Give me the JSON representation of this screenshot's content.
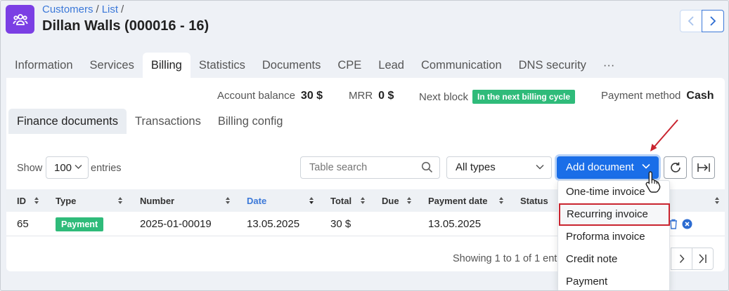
{
  "breadcrumb": {
    "items": [
      "Customers",
      "List"
    ]
  },
  "title": "Dillan Walls (000016 - 16)",
  "tabs": [
    {
      "label": "Information"
    },
    {
      "label": "Services"
    },
    {
      "label": "Billing"
    },
    {
      "label": "Statistics"
    },
    {
      "label": "Documents"
    },
    {
      "label": "CPE"
    },
    {
      "label": "Lead"
    },
    {
      "label": "Communication"
    },
    {
      "label": "DNS security"
    },
    {
      "label": "···"
    }
  ],
  "summary": {
    "balance_label": "Account balance",
    "balance_value": "30 $",
    "mrr_label": "MRR",
    "mrr_value": "0 $",
    "next_block_label": "Next block",
    "next_block_value": "In the next billing cycle",
    "payment_method_label": "Payment method",
    "payment_method_value": "Cash"
  },
  "subtabs": [
    {
      "label": "Finance documents"
    },
    {
      "label": "Transactions"
    },
    {
      "label": "Billing config"
    }
  ],
  "controls": {
    "show_label": "Show",
    "entries_value": "100",
    "entries_label": "entries",
    "search_placeholder": "Table search",
    "type_value": "All types",
    "add_label": "Add document"
  },
  "table": {
    "columns": [
      "ID",
      "Type",
      "Number",
      "Date",
      "Total",
      "Due",
      "Payment date",
      "Status"
    ],
    "rows": [
      {
        "id": "65",
        "type": "Payment",
        "number": "2025-01-00019",
        "date": "13.05.2025",
        "total": "30 $",
        "due": "",
        "payment_date": "13.05.2025"
      }
    ]
  },
  "footer": {
    "info": "Showing 1 to 1 of 1 ent"
  },
  "dropdown": {
    "items": [
      "One-time invoice",
      "Recurring invoice",
      "Proforma invoice",
      "Credit note",
      "Payment"
    ],
    "highlighted_index": 1
  },
  "colors": {
    "accent": "#1a6ee8",
    "brand": "#7b3fe4",
    "success": "#2fbb7a",
    "highlight": "#c9242f"
  }
}
